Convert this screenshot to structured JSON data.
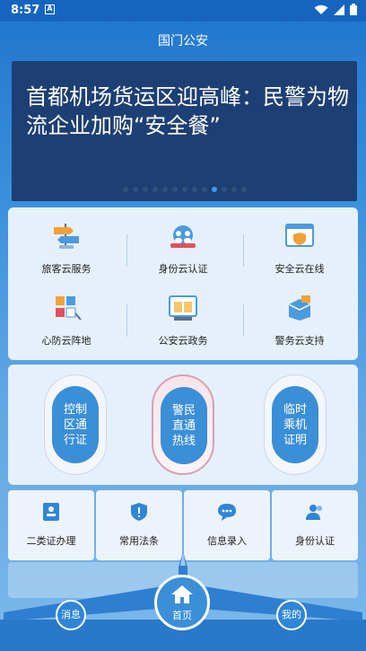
{
  "status": {
    "time": "8:57",
    "notification_badge": "A"
  },
  "header": {
    "title": "国门公安"
  },
  "banner": {
    "headline": "首都机场货运区迎高峰：民警为物流企业加购“安全餐”",
    "dot_count": 13,
    "active_dot": 9
  },
  "services": [
    {
      "label": "旅客云服务",
      "icon": "signpost-icon"
    },
    {
      "label": "身份云认证",
      "icon": "globe-people-icon"
    },
    {
      "label": "安全云在线",
      "icon": "browser-shield-icon"
    },
    {
      "label": "心防云阵地",
      "icon": "cubes-icon"
    },
    {
      "label": "公安云政务",
      "icon": "book-screen-icon"
    },
    {
      "label": "警务云支持",
      "icon": "boxes-icon"
    }
  ],
  "hotline": [
    {
      "label": "控制区通行证"
    },
    {
      "label": "警民直通热线"
    },
    {
      "label": "临时乘机证明"
    }
  ],
  "quick": [
    {
      "label": "二类证办理",
      "icon": "id-card-icon"
    },
    {
      "label": "常用法条",
      "icon": "shield-badge-icon"
    },
    {
      "label": "信息录入",
      "icon": "chat-bubble-icon"
    },
    {
      "label": "身份认证",
      "icon": "users-icon"
    }
  ],
  "nav": {
    "messages": "消息",
    "home": "首页",
    "mine": "我的"
  },
  "colors": {
    "primary": "#2f86d6",
    "banner_bg": "#1d3f73",
    "card_bg": "#e6f0fa"
  }
}
